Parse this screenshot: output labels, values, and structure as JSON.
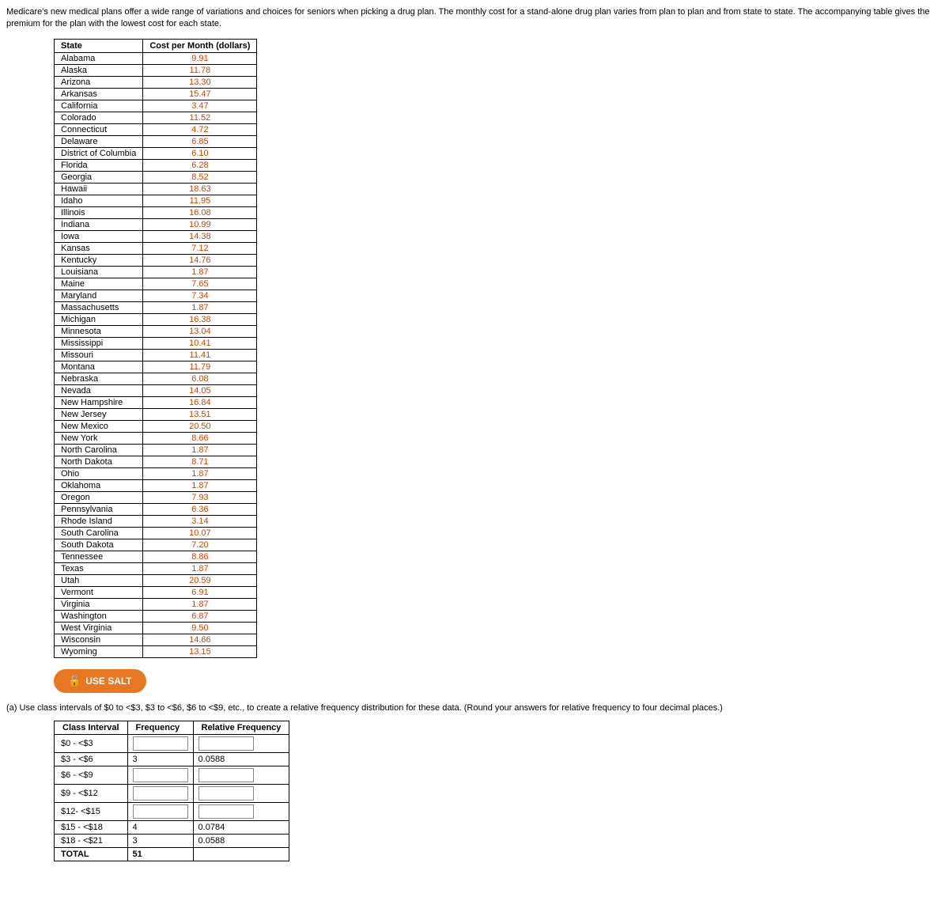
{
  "intro": {
    "text": "Medicare's new medical plans offer a wide range of variations and choices for seniors when picking a drug plan. The monthly cost for a stand-alone drug plan varies from plan to plan and from state to state. The accompanying table gives the premium for the plan with the lowest cost for each state."
  },
  "table": {
    "headers": [
      "State",
      "Cost per Month (dollars)"
    ],
    "rows": [
      [
        "Alabama",
        "9.91"
      ],
      [
        "Alaska",
        "11.78"
      ],
      [
        "Arizona",
        "13.30"
      ],
      [
        "Arkansas",
        "15.47"
      ],
      [
        "California",
        "3.47"
      ],
      [
        "Colorado",
        "11.52"
      ],
      [
        "Connecticut",
        "4.72"
      ],
      [
        "Delaware",
        "6.85"
      ],
      [
        "District of Columbia",
        "6.10"
      ],
      [
        "Florida",
        "6.28"
      ],
      [
        "Georgia",
        "8.52"
      ],
      [
        "Hawaii",
        "18.63"
      ],
      [
        "Idaho",
        "11.95"
      ],
      [
        "Illinois",
        "16.08"
      ],
      [
        "Indiana",
        "10.99"
      ],
      [
        "Iowa",
        "14.38"
      ],
      [
        "Kansas",
        "7.12"
      ],
      [
        "Kentucky",
        "14.76"
      ],
      [
        "Louisiana",
        "1.87"
      ],
      [
        "Maine",
        "7.65"
      ],
      [
        "Maryland",
        "7.34"
      ],
      [
        "Massachusetts",
        "1.87"
      ],
      [
        "Michigan",
        "16.38"
      ],
      [
        "Minnesota",
        "13.04"
      ],
      [
        "Mississippi",
        "10.41"
      ],
      [
        "Missouri",
        "11.41"
      ],
      [
        "Montana",
        "11.79"
      ],
      [
        "Nebraska",
        "6.08"
      ],
      [
        "Nevada",
        "14.05"
      ],
      [
        "New Hampshire",
        "16.84"
      ],
      [
        "New Jersey",
        "13.51"
      ],
      [
        "New Mexico",
        "20.50"
      ],
      [
        "New York",
        "8.66"
      ],
      [
        "North Carolina",
        "1.87"
      ],
      [
        "North Dakota",
        "8.71"
      ],
      [
        "Ohio",
        "1.87"
      ],
      [
        "Oklahoma",
        "1.87"
      ],
      [
        "Oregon",
        "7.93"
      ],
      [
        "Pennsylvania",
        "6.36"
      ],
      [
        "Rhode Island",
        "3.14"
      ],
      [
        "South Carolina",
        "10.07"
      ],
      [
        "South Dakota",
        "7.20"
      ],
      [
        "Tennessee",
        "8.86"
      ],
      [
        "Texas",
        "1.87"
      ],
      [
        "Utah",
        "20.59"
      ],
      [
        "Vermont",
        "6.91"
      ],
      [
        "Virginia",
        "1.87"
      ],
      [
        "Washington",
        "6.87"
      ],
      [
        "West Virginia",
        "9.50"
      ],
      [
        "Wisconsin",
        "14.66"
      ],
      [
        "Wyoming",
        "13.15"
      ]
    ]
  },
  "salt_button": {
    "label": "USE SALT",
    "icon": "🔓"
  },
  "question": {
    "text": "(a) Use class intervals of $0 to <$3, $3 to <$6, $6 to <$9, etc., to create a relative frequency distribution for these data. (Round your answers for relative frequency to four decimal places.)"
  },
  "freq_table": {
    "headers": [
      "Class Interval",
      "Frequency",
      "Relative Frequency"
    ],
    "rows": [
      {
        "interval": "$0 - <$3",
        "frequency": "",
        "rel_frequency": ""
      },
      {
        "interval": "$3 - <$6",
        "frequency": "3",
        "rel_frequency": "0.0588"
      },
      {
        "interval": "$6 - <$9",
        "frequency": "",
        "rel_frequency": ""
      },
      {
        "interval": "$9 - <$12",
        "frequency": "",
        "rel_frequency": ""
      },
      {
        "interval": "$12- <$15",
        "frequency": "",
        "rel_frequency": ""
      },
      {
        "interval": "$15 - <$18",
        "frequency": "4",
        "rel_frequency": "0.0784"
      },
      {
        "interval": "$18 - <$21",
        "frequency": "3",
        "rel_frequency": "0.0588"
      }
    ],
    "total": {
      "label": "TOTAL",
      "frequency": "51",
      "rel_frequency": ""
    }
  }
}
